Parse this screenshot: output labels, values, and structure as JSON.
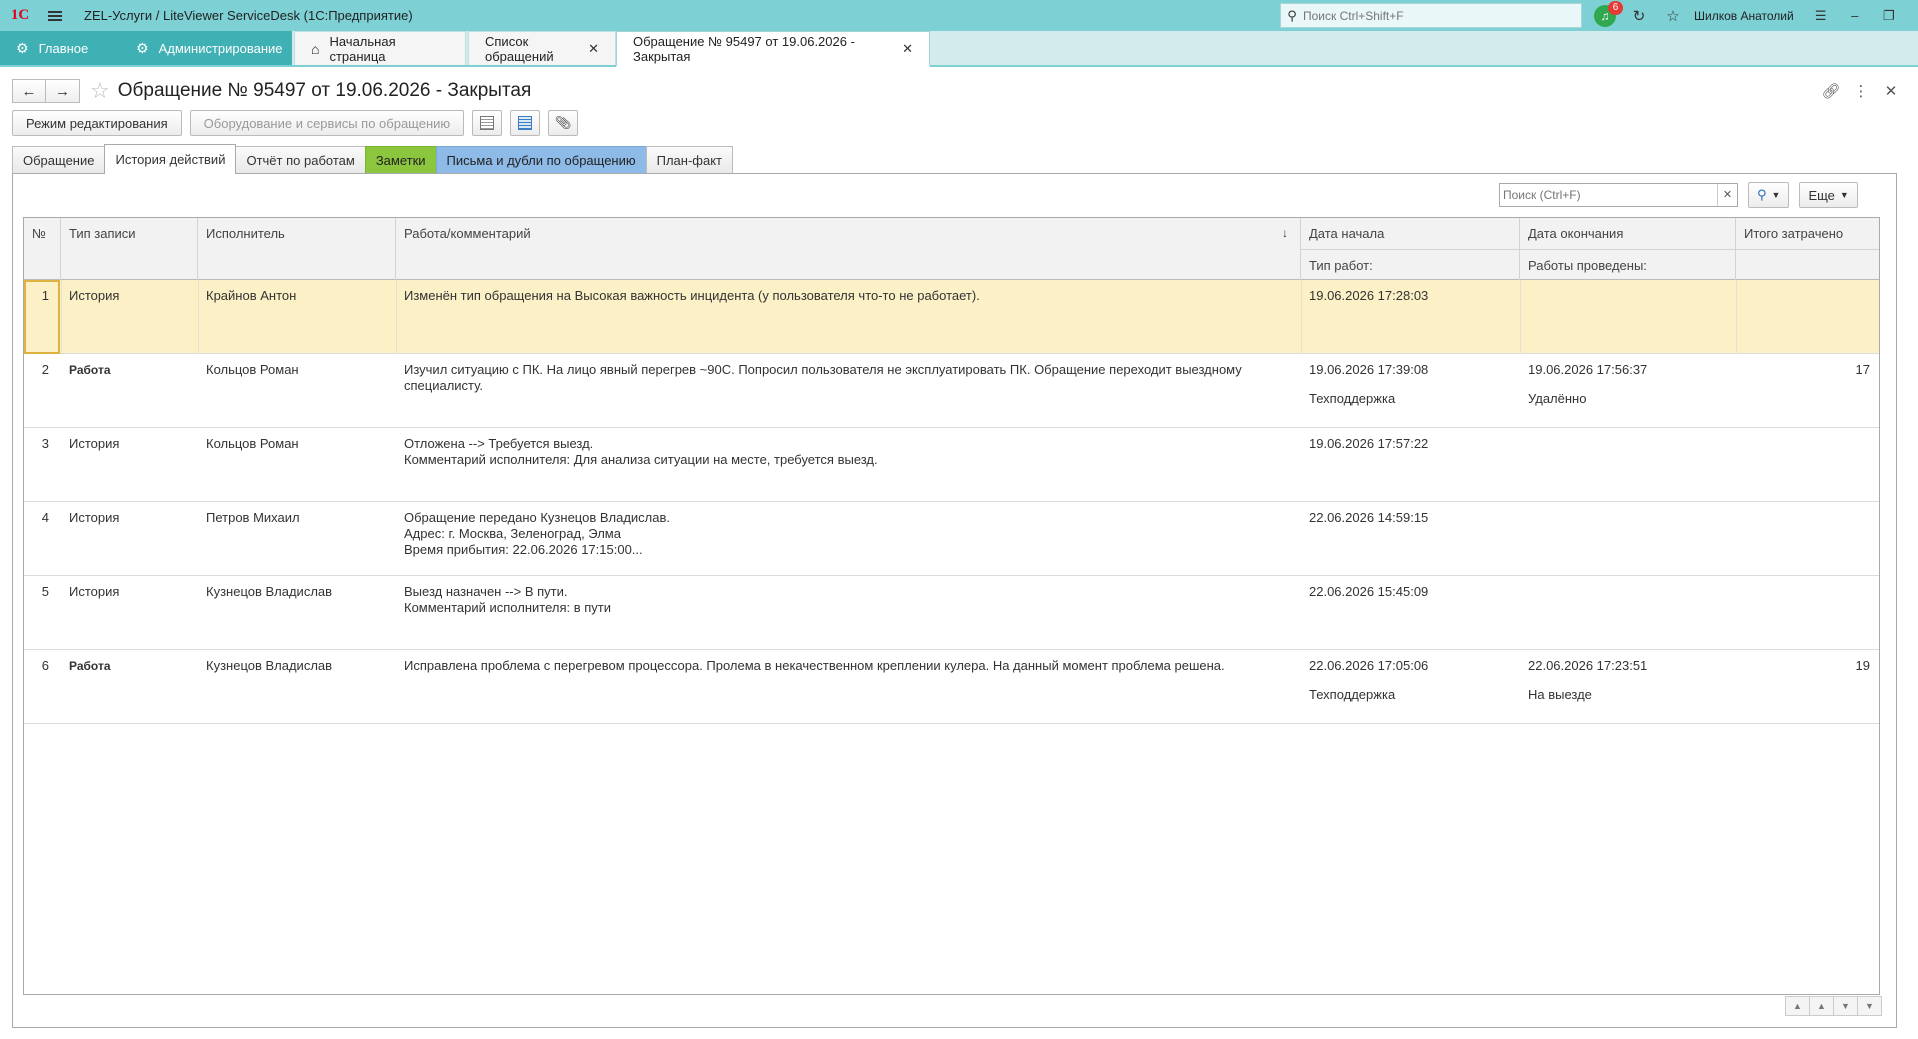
{
  "app": {
    "logo": "1С",
    "title": "ZEL-Услуги / LiteViewer ServiceDesk  (1С:Предприятие)",
    "search_placeholder": "Поиск Ctrl+Shift+F",
    "notifications_count": "6",
    "user": "Шилков Анатолий"
  },
  "sections": [
    {
      "label": "Главное"
    },
    {
      "label": "Администрирование"
    },
    {
      "label": "Начальная страница"
    },
    {
      "label": "Список обращений"
    },
    {
      "label": "Обращение № 95497 от 19.06.2026 - Закрытая"
    }
  ],
  "form": {
    "title": "Обращение № 95497 от 19.06.2026 - Закрытая",
    "edit_mode_button": "Режим редактирования",
    "equipment_button": "Оборудование и сервисы по обращению"
  },
  "tabs": [
    {
      "label": "Обращение"
    },
    {
      "label": "История действий"
    },
    {
      "label": "Отчёт по работам"
    },
    {
      "label": "Заметки"
    },
    {
      "label": "Письма и дубли по обращению"
    },
    {
      "label": "План-факт"
    }
  ],
  "grid_search": {
    "placeholder": "Поиск (Ctrl+F)",
    "more_button": "Еще"
  },
  "grid": {
    "headers": {
      "num": "№",
      "type": "Тип записи",
      "executor": "Исполнитель",
      "comment": "Работа/комментарий",
      "start": "Дата начала",
      "end": "Дата окончания",
      "total": "Итого затрачено",
      "work_type": "Тип работ:",
      "work_done": "Работы проведены:"
    },
    "rows": [
      {
        "num": "1",
        "type": "История",
        "executor": "Крайнов Антон",
        "comment": "Изменён тип обращения на Высокая важность инцидента (у пользователя что-то не работает).",
        "start": "19.06.2026 17:28:03",
        "end": "",
        "total": "",
        "work_type": "",
        "work_done": ""
      },
      {
        "num": "2",
        "type": "Работа",
        "executor": "Кольцов Роман",
        "comment": "Изучил ситуацию с ПК. На лицо явный перегрев ~90С. Попросил пользователя не эксплуатировать ПК. Обращение переходит выездному\nспециалисту.",
        "start": "19.06.2026 17:39:08",
        "end": "19.06.2026 17:56:37",
        "total": "17",
        "work_type": "Техподдержка",
        "work_done": "Удалённо"
      },
      {
        "num": "3",
        "type": "История",
        "executor": "Кольцов Роман",
        "comment": "Отложена --> Требуется выезд.\nКомментарий исполнителя: Для анализа ситуации на месте, требуется выезд.",
        "start": "19.06.2026 17:57:22",
        "end": "",
        "total": "",
        "work_type": "",
        "work_done": ""
      },
      {
        "num": "4",
        "type": "История",
        "executor": "Петров Михаил",
        "comment": "Обращение передано Кузнецов Владислав.\nАдрес: г. Москва, Зеленоград, Элма\nВремя прибытия: 22.06.2026 17:15:00...",
        "start": "22.06.2026 14:59:15",
        "end": "",
        "total": "",
        "work_type": "",
        "work_done": ""
      },
      {
        "num": "5",
        "type": "История",
        "executor": "Кузнецов Владислав",
        "comment": "Выезд назначен --> В пути.\nКомментарий исполнителя: в пути",
        "start": "22.06.2026 15:45:09",
        "end": "",
        "total": "",
        "work_type": "",
        "work_done": ""
      },
      {
        "num": "6",
        "type": "Работа",
        "executor": "Кузнецов Владислав",
        "comment": "Исправлена проблема с перегревом процессора. Пролема в некачественном креплении кулера. На данный момент проблема решена.",
        "start": "22.06.2026 17:05:06",
        "end": "22.06.2026 17:23:51",
        "total": "19",
        "work_type": "Техподдержка",
        "work_done": "На выезде"
      }
    ]
  }
}
